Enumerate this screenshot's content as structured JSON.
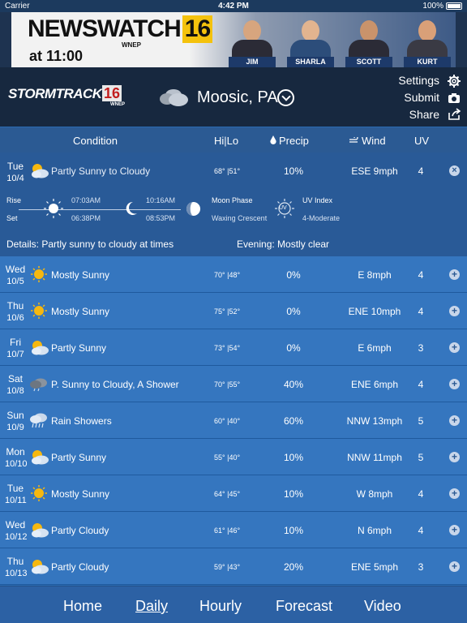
{
  "status_bar": {
    "carrier": "Carrier",
    "time": "4:42 PM",
    "battery": "100%"
  },
  "banner": {
    "title": "NEWSWATCH",
    "number": "16",
    "station": "WNEP",
    "time": "at 11:00",
    "anchors": [
      "JIM",
      "SHARLA",
      "SCOTT",
      "KURT"
    ]
  },
  "header": {
    "logo_text": "STORMTRACKER",
    "logo_number": "16",
    "logo_station": "WNEP",
    "location": "Moosic, PA",
    "settings_label": "Settings",
    "submit_label": "Submit",
    "share_label": "Share"
  },
  "columns": {
    "condition": "Condition",
    "hilo": "Hi|Lo",
    "precip": "Precip",
    "wind": "Wind",
    "uv": "UV"
  },
  "today": {
    "day": "Tue",
    "date": "10/4",
    "icon": "partly-sunny-icon",
    "condition": "Partly Sunny to Cloudy",
    "hilo": "68° |51°",
    "precip": "10%",
    "wind": "ESE 9mph",
    "uv": "4",
    "rise_label": "Rise",
    "set_label": "Set",
    "sunrise": "07:03AM",
    "sunset": "06:38PM",
    "moonrise": "10:16AM",
    "moonset": "08:53PM",
    "moon_phase_label": "Moon Phase",
    "moon_phase": "Waxing Crescent",
    "uv_index_label": "UV Index",
    "uv_index": "4-Moderate",
    "uv_badge": "UV",
    "details": "Details: Partly sunny to cloudy at times",
    "evening": "Evening: Mostly clear"
  },
  "forecast": [
    {
      "day": "Wed",
      "date": "10/5",
      "icon": "sunny-icon",
      "condition": "Mostly Sunny",
      "hilo": "70° |48°",
      "precip": "0%",
      "wind": "E 8mph",
      "uv": "4"
    },
    {
      "day": "Thu",
      "date": "10/6",
      "icon": "sunny-icon",
      "condition": "Mostly Sunny",
      "hilo": "75° |52°",
      "precip": "0%",
      "wind": "ENE 10mph",
      "uv": "4"
    },
    {
      "day": "Fri",
      "date": "10/7",
      "icon": "partly-sunny-icon",
      "condition": "Partly Sunny",
      "hilo": "73° |54°",
      "precip": "0%",
      "wind": "E 6mph",
      "uv": "3"
    },
    {
      "day": "Sat",
      "date": "10/8",
      "icon": "shower-cloud-icon",
      "condition": "P. Sunny to Cloudy, A Shower",
      "hilo": "70° |55°",
      "precip": "40%",
      "wind": "ENE 6mph",
      "uv": "4"
    },
    {
      "day": "Sun",
      "date": "10/9",
      "icon": "rain-icon",
      "condition": "Rain Showers",
      "hilo": "60° |40°",
      "precip": "60%",
      "wind": "NNW 13mph",
      "uv": "5"
    },
    {
      "day": "Mon",
      "date": "10/10",
      "icon": "partly-sunny-icon",
      "condition": "Partly Sunny",
      "hilo": "55° |40°",
      "precip": "10%",
      "wind": "NNW 11mph",
      "uv": "5"
    },
    {
      "day": "Tue",
      "date": "10/11",
      "icon": "sunny-icon",
      "condition": "Mostly Sunny",
      "hilo": "64° |45°",
      "precip": "10%",
      "wind": "W 8mph",
      "uv": "4"
    },
    {
      "day": "Wed",
      "date": "10/12",
      "icon": "partly-sunny-icon",
      "condition": "Partly Cloudy",
      "hilo": "61° |46°",
      "precip": "10%",
      "wind": "N 6mph",
      "uv": "4"
    },
    {
      "day": "Thu",
      "date": "10/13",
      "icon": "partly-sunny-icon",
      "condition": "Partly Cloudy",
      "hilo": "59° |43°",
      "precip": "20%",
      "wind": "ENE 5mph",
      "uv": "3"
    }
  ],
  "tabs": [
    "Home",
    "Daily",
    "Hourly",
    "Forecast",
    "Video"
  ],
  "active_tab": "Daily",
  "colors": {
    "header_bg": "#17283f",
    "row_bg": "#3576bf",
    "today_bg": "#295a97",
    "accent_yellow": "#f4c20d"
  }
}
